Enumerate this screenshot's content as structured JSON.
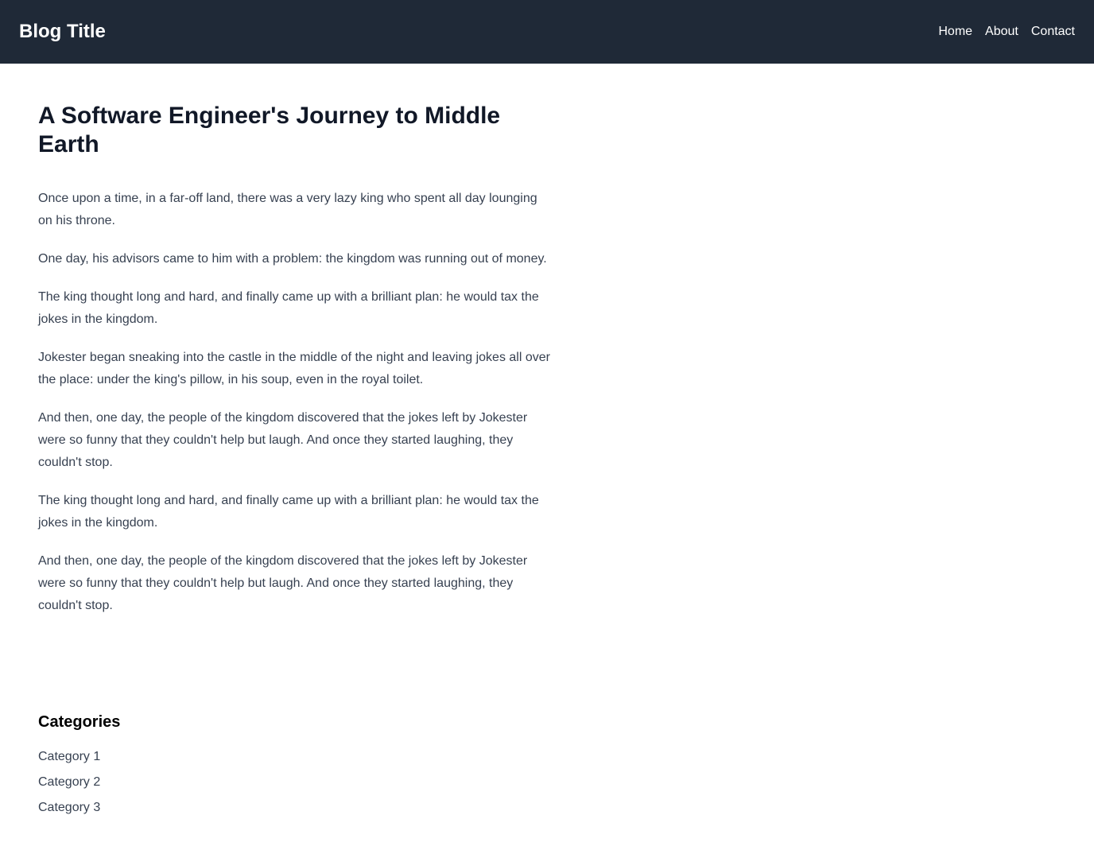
{
  "header": {
    "brand": "Blog Title",
    "nav": [
      "Home",
      "About",
      "Contact"
    ]
  },
  "post": {
    "title": "A Software Engineer's Journey to Middle Earth",
    "paragraphs": [
      "Once upon a time, in a far-off land, there was a very lazy king who spent all day lounging on his throne.",
      "One day, his advisors came to him with a problem: the kingdom was running out of money.",
      "The king thought long and hard, and finally came up with a brilliant plan: he would tax the jokes in the kingdom.",
      "Jokester began sneaking into the castle in the middle of the night and leaving jokes all over the place: under the king's pillow, in his soup, even in the royal toilet.",
      "And then, one day, the people of the kingdom discovered that the jokes left by Jokester were so funny that they couldn't help but laugh. And once they started laughing, they couldn't stop.",
      "The king thought long and hard, and finally came up with a brilliant plan: he would tax the jokes in the kingdom.",
      "And then, one day, the people of the kingdom discovered that the jokes left by Jokester were so funny that they couldn't help but laugh. And once they started laughing, they couldn't stop."
    ]
  },
  "sidebar": {
    "heading": "Categories",
    "categories": [
      "Category 1",
      "Category 2",
      "Category 3"
    ]
  },
  "colors": {
    "header_bg": "#1f2937",
    "header_text": "#ffffff",
    "title_text": "#111827",
    "body_text": "#374151"
  }
}
